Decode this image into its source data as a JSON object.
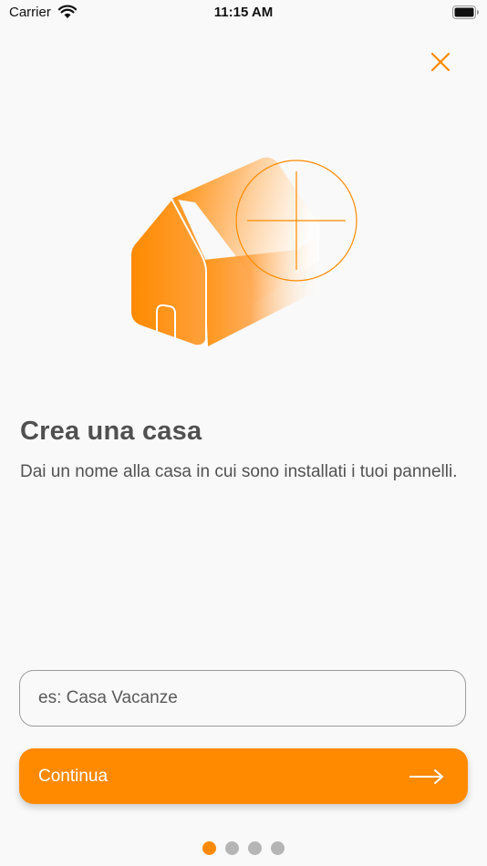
{
  "status_bar": {
    "carrier": "Carrier",
    "time": "11:15 AM"
  },
  "icons": {
    "close": "close-icon",
    "wifi": "wifi-icon",
    "battery": "battery-icon",
    "arrow": "arrow-right-icon",
    "illustration": "house-add-illustration"
  },
  "colors": {
    "accent": "#ff8a00",
    "inactive_dot": "#b5b5b5",
    "text": "#505050",
    "background": "#f9f9f9"
  },
  "main": {
    "title": "Crea una casa",
    "subtitle": "Dai un nome alla casa in cui sono installati i tuoi pannelli."
  },
  "form": {
    "name_placeholder": "es: Casa Vacanze",
    "name_value": "",
    "continue_label": "Continua"
  },
  "pagination": {
    "total": 4,
    "current": 1
  }
}
